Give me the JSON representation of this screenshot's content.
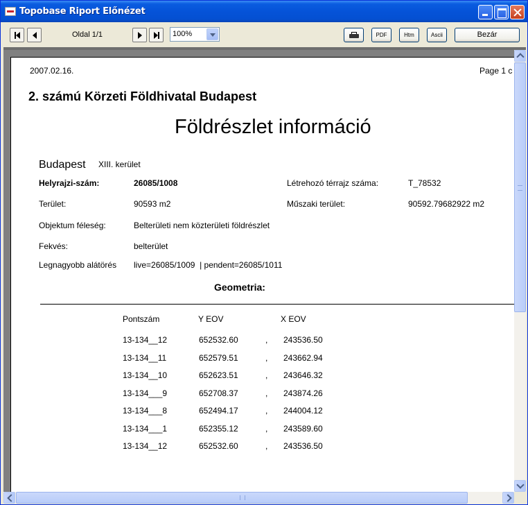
{
  "window": {
    "title": "Topobase Riport Előnézet"
  },
  "toolbar": {
    "page_label": "Oldal 1/1",
    "zoom_value": "100%",
    "pdf_label": "PDF",
    "htm_label": "Htm",
    "ascii_label": "Ascii",
    "close_label": "Bezár"
  },
  "report": {
    "date": "2007.02.16.",
    "page_indicator": "Page 1 c",
    "office": "2. számú Körzeti Földhivatal Budapest",
    "title": "Földrészlet információ",
    "city": "Budapest",
    "district": "XIII. kerület",
    "fields": {
      "hrsz_label": "Helyrajzi-szám:",
      "hrsz_value": "26085/1008",
      "terrajz_label": "Létrehozó térrajz száma:",
      "terrajz_value": "T_78532",
      "terulet_label": "Terület:",
      "terulet_value": "90593 m2",
      "muszaki_label": "Műszaki terület:",
      "muszaki_value": "90592.79682922 m2",
      "objektum_label": "Objektum féleség:",
      "objektum_value": "Belterületi nem közterületi földrészlet",
      "fekves_label": "Fekvés:",
      "fekves_value": "belterület",
      "alatores_label": "Legnagyobb alátörés",
      "alatores_value": "live=26085/1009  | pendent=26085/1011"
    },
    "geometry_heading": "Geometria:",
    "table": {
      "headers": [
        "Pontszám",
        "Y EOV",
        "X EOV"
      ],
      "separator": ",",
      "rows": [
        [
          "13-134__12",
          "652532.60",
          "243536.50"
        ],
        [
          "13-134__11",
          "652579.51",
          "243662.94"
        ],
        [
          "13-134__10",
          "652623.51",
          "243646.32"
        ],
        [
          "13-134___9",
          "652708.37",
          "243874.26"
        ],
        [
          "13-134___8",
          "652494.17",
          "244004.12"
        ],
        [
          "13-134___1",
          "652355.12",
          "243589.60"
        ],
        [
          "13-134__12",
          "652532.60",
          "243536.50"
        ]
      ]
    }
  }
}
